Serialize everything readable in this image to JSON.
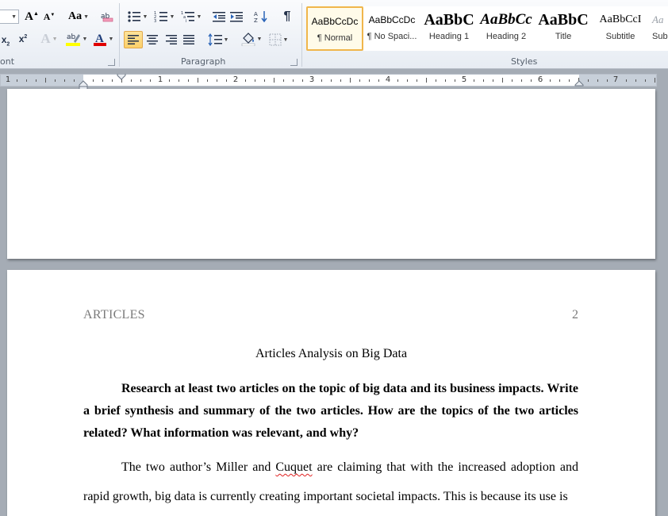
{
  "ribbon": {
    "font_size_value": "",
    "case_button_label": "Aa",
    "groups": {
      "font": "ont",
      "paragraph": "Paragraph",
      "styles": "Styles"
    },
    "styles": [
      {
        "preview": "AaBbCcDc",
        "name": "¶ Normal",
        "selected": true
      },
      {
        "preview": "AaBbCcDc",
        "name": "¶ No Spaci..."
      },
      {
        "preview": "AaBbC",
        "name": "Heading 1"
      },
      {
        "preview": "AaBbCc",
        "name": "Heading 2"
      },
      {
        "preview": "AaBbC",
        "name": "Title"
      },
      {
        "preview": "AaBbCcI",
        "name": "Subtitle"
      },
      {
        "preview": "Aa",
        "name": "Sub"
      }
    ],
    "colors": {
      "highlight": "#ffff00",
      "font_color": "#e00000",
      "accent": "#f0b64b"
    }
  },
  "ruler": {
    "numbers": [
      "1",
      "1",
      "2",
      "3",
      "4",
      "5",
      "6",
      "7"
    ]
  },
  "document": {
    "header_left": "ARTICLES",
    "header_right": "2",
    "title": "Articles Analysis on Big Data",
    "prompt": "Research at least two articles on the topic of big data and its business impacts. Write a brief synthesis and summary of the two articles. How are the topics of the two articles related? What information was relevant, and why?",
    "body_before": "The two author’s Miller and ",
    "body_misspelled": "Cuquet",
    "body_after": " are claiming that with the increased adoption and rapid growth, big data is currently creating important societal impacts. This is because its use is"
  }
}
